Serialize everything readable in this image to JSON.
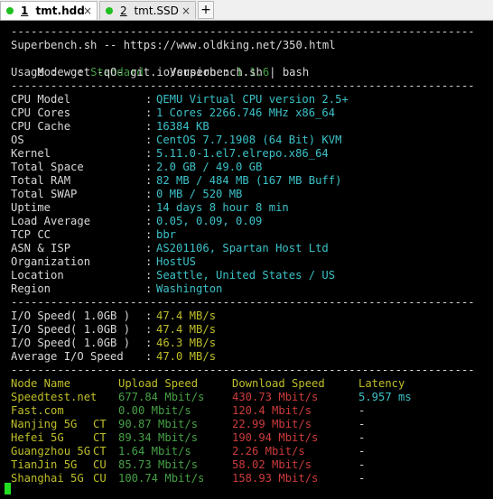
{
  "tabs": [
    {
      "number": "1",
      "label": "tmt.hdd",
      "dot_color": "#1fbf1f",
      "close": "×"
    },
    {
      "number": "2",
      "label": "tmt.SSD",
      "dot_color": "#1fbf1f",
      "close": "×"
    }
  ],
  "add_tab_label": "+",
  "separator": "----------------------------------------------------------------------",
  "header": {
    "line1": "Superbench.sh -- https://www.oldking.net/350.html",
    "mode_label": "Mode  : ",
    "mode_value": "Standard",
    "version_label": "    Version : ",
    "version_value": "1.1.6",
    "usage": "Usage : wget -qO- git.io/superbench.sh | bash"
  },
  "sysinfo": [
    {
      "label": "CPU Model",
      "value": "QEMU Virtual CPU version 2.5+"
    },
    {
      "label": "CPU Cores",
      "value": "1 Cores 2266.746 MHz x86_64"
    },
    {
      "label": "CPU Cache",
      "value": "16384 KB"
    },
    {
      "label": "OS",
      "value": "CentOS 7.7.1908 (64 Bit) KVM"
    },
    {
      "label": "Kernel",
      "value": "5.11.0-1.el7.elrepo.x86_64"
    },
    {
      "label": "Total Space",
      "value": "2.0 GB / 49.0 GB"
    },
    {
      "label": "Total RAM",
      "value": "82 MB / 484 MB (167 MB Buff)"
    },
    {
      "label": "Total SWAP",
      "value": "0 MB / 520 MB"
    },
    {
      "label": "Uptime",
      "value": "14 days 8 hour 8 min"
    },
    {
      "label": "Load Average",
      "value": "0.05, 0.09, 0.09"
    },
    {
      "label": "TCP CC",
      "value": "bbr"
    },
    {
      "label": "ASN & ISP",
      "value": "AS201106, Spartan Host Ltd"
    },
    {
      "label": "Organization",
      "value": "HostUS"
    },
    {
      "label": "Location",
      "value": "Seattle, United States / US"
    },
    {
      "label": "Region",
      "value": "Washington"
    }
  ],
  "io": [
    {
      "label": "I/O Speed( 1.0GB )",
      "value": "47.4 MB/s"
    },
    {
      "label": "I/O Speed( 1.0GB )",
      "value": "47.4 MB/s"
    },
    {
      "label": "I/O Speed( 1.0GB )",
      "value": "46.3 MB/s"
    },
    {
      "label": "Average I/O Speed",
      "value": "47.0 MB/s"
    }
  ],
  "speed_headers": {
    "node": "Node Name",
    "upload": "Upload Speed",
    "download": "Download Speed",
    "latency": "Latency"
  },
  "speed_rows": [
    {
      "node": "Speedtest.net",
      "isp": "",
      "upload": "677.84 Mbit/s",
      "download": "430.73 Mbit/s",
      "latency": "5.957 ms"
    },
    {
      "node": "Fast.com",
      "isp": "",
      "upload": "0.00 Mbit/s",
      "download": "120.4 Mbit/s",
      "latency": "-"
    },
    {
      "node": "Nanjing 5G",
      "isp": "CT",
      "upload": "90.87 Mbit/s",
      "download": "22.99 Mbit/s",
      "latency": "-"
    },
    {
      "node": "Hefei 5G",
      "isp": "CT",
      "upload": "89.34 Mbit/s",
      "download": "190.94 Mbit/s",
      "latency": "-"
    },
    {
      "node": "Guangzhou 5G",
      "isp": "CT",
      "upload": "1.64 Mbit/s",
      "download": "2.26 Mbit/s",
      "latency": "-"
    },
    {
      "node": "TianJin 5G",
      "isp": "CU",
      "upload": "85.73 Mbit/s",
      "download": "58.02 Mbit/s",
      "latency": "-"
    },
    {
      "node": "Shanghai 5G",
      "isp": "CU",
      "upload": "100.74 Mbit/s",
      "download": "158.93 Mbit/s",
      "latency": "-"
    }
  ],
  "colon": ":"
}
